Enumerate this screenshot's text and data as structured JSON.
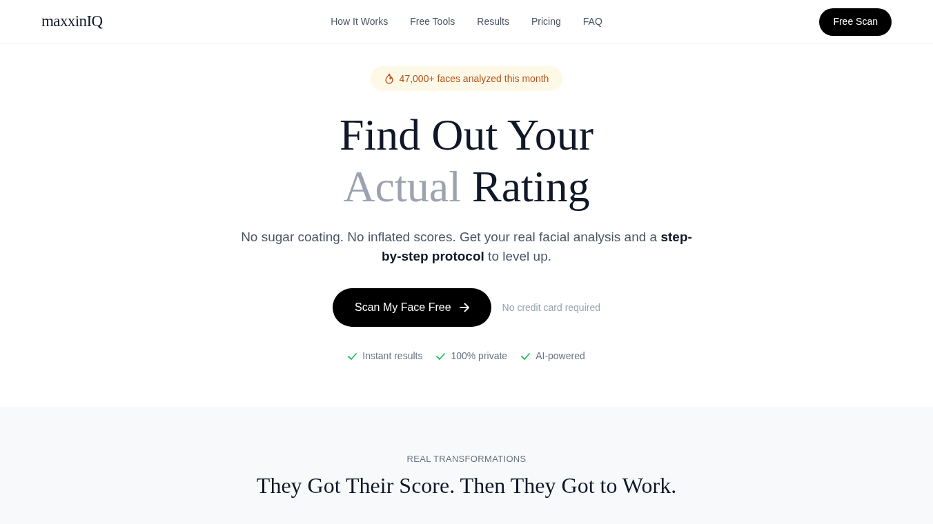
{
  "header": {
    "logo": "maxxinIQ",
    "nav": [
      "How It Works",
      "Free Tools",
      "Results",
      "Pricing",
      "FAQ"
    ],
    "cta": "Free Scan"
  },
  "hero": {
    "badge": "47,000+ faces analyzed this month",
    "heading": [
      [
        {
          "text": "Find Out Your",
          "muted": false
        }
      ],
      [
        {
          "text": "Actual",
          "muted": true
        },
        {
          "text": "Rating",
          "muted": false
        }
      ]
    ],
    "subtitle": "No sugar coating. No inflated scores. Get your real facial analysis and a **step-by-step protocol** to level up.",
    "cta": "Scan My Face Free",
    "cta_note": "No credit card required",
    "features": [
      "Instant results",
      "100% private",
      "AI-powered"
    ]
  },
  "transformations": {
    "eyebrow": "REAL TRANSFORMATIONS",
    "heading": "They Got Their Score. Then They Got to Work."
  }
}
